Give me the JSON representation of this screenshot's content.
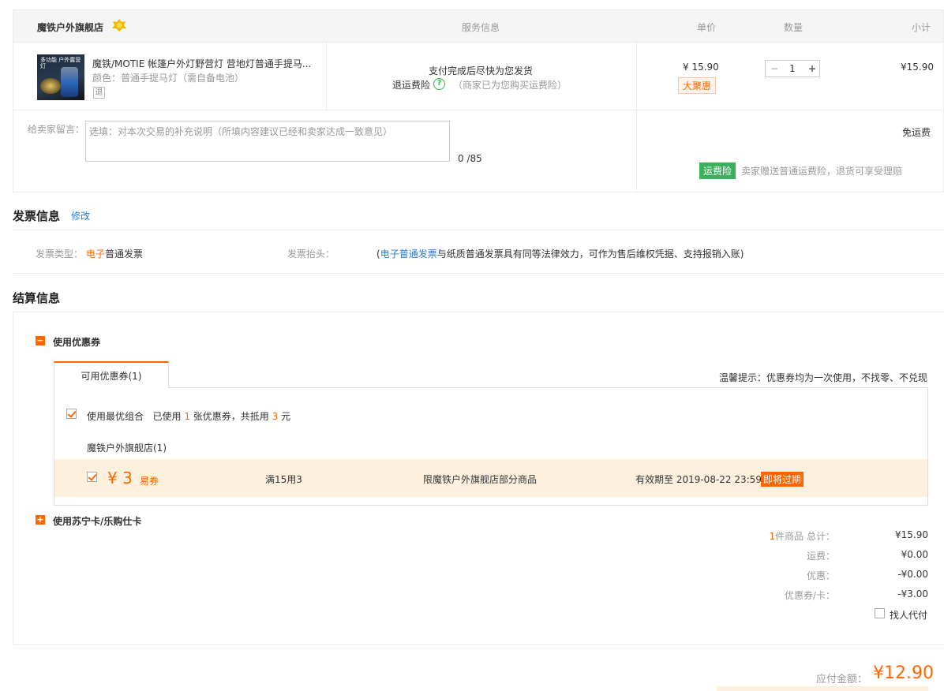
{
  "order": {
    "shop_name": "魔铁户外旗舰店",
    "shop_badge_icon": "gold-badge-icon",
    "headers": {
      "service": "服务信息",
      "unit_price": "单价",
      "quantity": "数量",
      "subtotal": "小计"
    },
    "product": {
      "thumb_text": "多功能 户外露营灯",
      "title": "魔铁/MOTIE 帐篷户外灯野营灯 营地灯普通手提马...",
      "color_label": "颜色：",
      "color_value": "普通手提马灯（需自备电池）",
      "return_tag": "退",
      "service_line1": "支付完成后尽快为您发货",
      "service_insurance": "退运费险",
      "service_insurance_note": "（商家已为您购买运费险）",
      "price": "¥ 15.90",
      "promo_tag": "大聚惠",
      "qty_minus": "−",
      "quantity": "1",
      "qty_plus": "+",
      "subtotal": "¥15.90"
    },
    "message_label": "给卖家留言：",
    "message_placeholder": "选填：对本次交易的补充说明（所填内容建议已经和卖家达成一致意见）",
    "message_count": "0 /85",
    "shipping": "免运费",
    "insurance_badge": "运费险",
    "insurance_text": "卖家赠送普通运费险，退货可享受理赔"
  },
  "invoice": {
    "title": "发票信息",
    "edit": "修改",
    "type_label": "发票类型：",
    "type_prefix": "电子",
    "type_value": "普通发票",
    "header_label": "发票抬头：",
    "note_open": "(",
    "note_link": "电子普通发票",
    "note_rest": "与纸质普通发票具有同等法律效力，可作为售后维权凭据、支持报销入账)"
  },
  "settlement": {
    "title": "结算信息",
    "coupon_section": "使用优惠券",
    "coupon_tab": "可用优惠券(1)",
    "tip": "温馨提示：优惠券均为一次使用，不找零、不兑现",
    "best_combo": "使用最优组合",
    "used_pre": "已使用",
    "used_count": "1",
    "used_mid": "张优惠券，共抵用",
    "used_amount": "3",
    "used_post": "元",
    "shop_group": "魔铁户外旗舰店(1)",
    "coupon": {
      "amount": "¥ 3",
      "type": "易券",
      "condition": "满15用3",
      "scope": "限魔铁户外旗舰店部分商品",
      "expiry": "有效期至 2019-08-22 23:59",
      "expire_badge": "即将过期"
    },
    "card_section": "使用苏宁卡/乐购仕卡",
    "summary": {
      "goods_count": "1",
      "goods_label": "件商品 总计：",
      "goods_total": "¥15.90",
      "shipping_label": "运费：",
      "shipping_value": "¥0.00",
      "discount_label": "优惠：",
      "discount_value": "-¥0.00",
      "coupon_label": "优惠券/卡：",
      "coupon_value": "-¥3.00",
      "proxy_pay": "找人代付"
    }
  },
  "payment": {
    "label": "应付金额：",
    "amount": "¥12.90"
  },
  "colors": {
    "accent": "#ff6600",
    "link": "#2a7ad2",
    "green": "#3bb15d",
    "coupon_row_bg": "#fdf1de"
  }
}
